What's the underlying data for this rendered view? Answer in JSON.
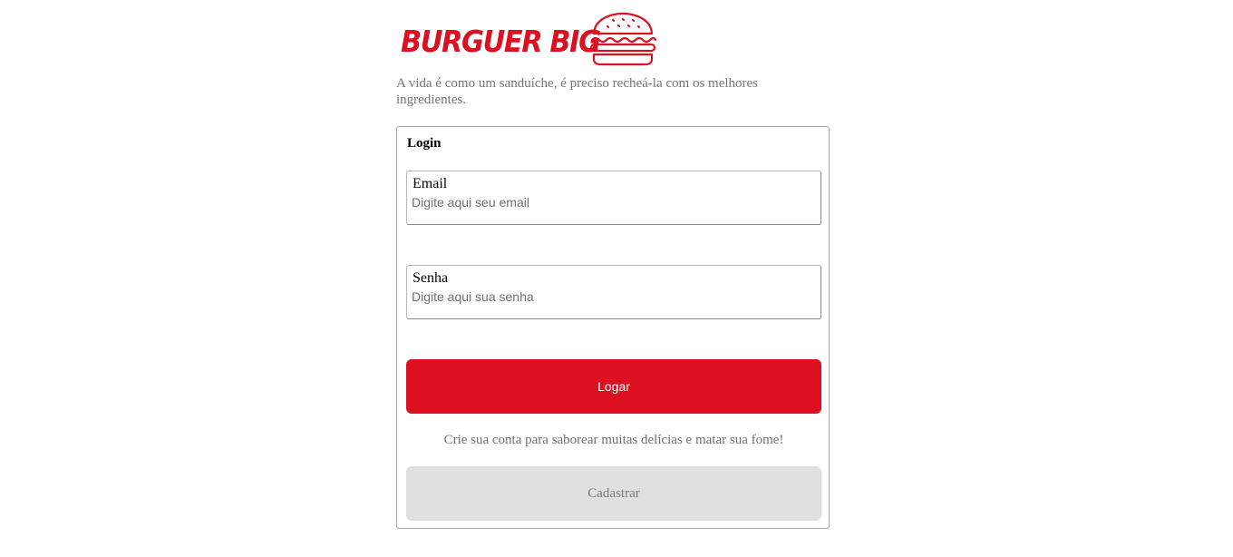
{
  "brand": {
    "name": "BURGUER BIG",
    "icon": "burger-icon",
    "color": "#dc1021"
  },
  "tagline": "A vida é como um sanduíche, é preciso recheá-la com os melhores ingredientes.",
  "login": {
    "title": "Login",
    "email": {
      "label": "Email",
      "placeholder": "Digite aqui seu email",
      "value": ""
    },
    "password": {
      "label": "Senha",
      "placeholder": "Digite aqui sua senha",
      "value": ""
    },
    "submit_label": "Logar",
    "signup_prompt": "Crie sua conta para saborear muitas delícias e matar sua fome!",
    "signup_label": "Cadastrar"
  },
  "colors": {
    "primary": "#dc1021",
    "secondary_button": "#e0e0e0",
    "muted_text": "#757575"
  }
}
